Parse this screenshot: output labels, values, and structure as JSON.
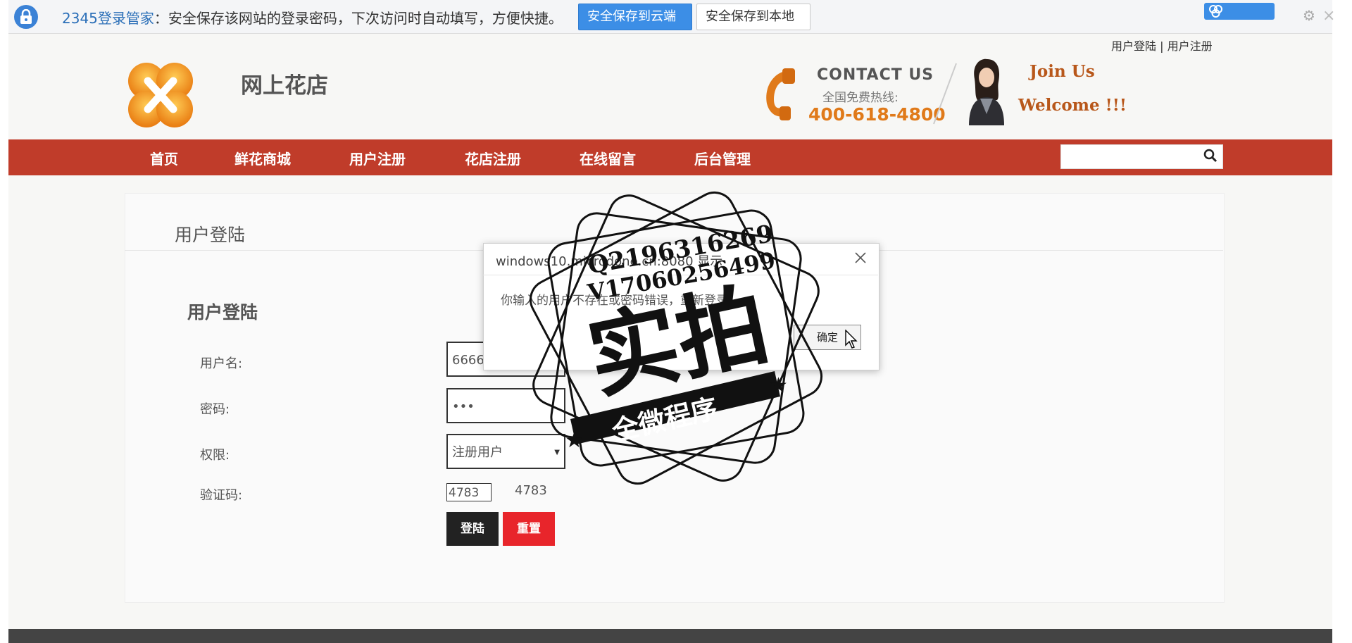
{
  "password_bar": {
    "brand": "2345登录管家",
    "message": "：安全保存该网站的登录密码，下次访问时自动填写，方便快捷。",
    "save_cloud": "安全保存到云端",
    "save_local": "安全保存到本地"
  },
  "header": {
    "links": [
      "用户登陆",
      "用户注册"
    ],
    "site_name": "网上花店",
    "contact_title": "CONTACT US",
    "hotline_label": "全国免费热线:",
    "phone": "400-618-4800",
    "join_us": "Join Us",
    "welcome": "Welcome !!!"
  },
  "nav": {
    "items": [
      "首页",
      "鲜花商城",
      "用户注册",
      "花店注册",
      "在线留言",
      "后台管理"
    ],
    "search_value": ""
  },
  "content": {
    "card_title": "用户登陆",
    "form_title": "用户登陆",
    "username_label": "用户名:",
    "username_value": "66666",
    "password_label": "密码:",
    "password_value": "•••",
    "role_label": "权限:",
    "role_value": "注册用户",
    "captcha_label": "验证码:",
    "captcha_input": "4783",
    "captcha_text": "4783",
    "login_button": "登陆",
    "reset_button": "重置"
  },
  "dialog": {
    "title": "windows10.microdone.cn:8080 显示",
    "message": "你输入的用户不存在或密码错误，重新登录",
    "ok": "确定"
  },
  "watermark": {
    "line1": "Q2196316269",
    "line2": "V17060256499",
    "big": "实拍",
    "ribbon": "全微程序"
  },
  "colors": {
    "nav_bg": "#c03c2a",
    "accent_orange": "#e07a1a",
    "reset_red": "#e8252b",
    "cloud_blue": "#3c8ee6"
  }
}
